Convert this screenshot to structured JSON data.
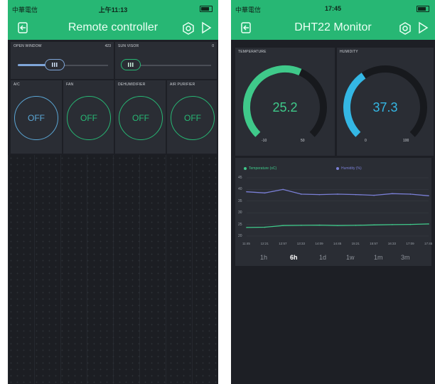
{
  "left": {
    "status": {
      "carrier": "中華電信",
      "time": "上午11:13"
    },
    "title": "Remote controller",
    "sliders": [
      {
        "label": "OPEN WINDOW",
        "value": "423",
        "level": 0.42
      },
      {
        "label": "SUN VISOR",
        "value": "0",
        "level": 0.0
      }
    ],
    "buttons": [
      {
        "label": "A/C",
        "state": "OFF"
      },
      {
        "label": "FAN",
        "state": "OFF"
      },
      {
        "label": "DEHUMIDIFIER",
        "state": "OFF"
      },
      {
        "label": "AIR PURIFIER",
        "state": "OFF"
      }
    ],
    "colors": {
      "accent": "#27b774",
      "slider": "#7fa6d9",
      "button_blue": "#5ba7d6"
    }
  },
  "right": {
    "status": {
      "carrier": "中華電信",
      "time": "17:45"
    },
    "title": "DHT22 Monitor",
    "gauges": [
      {
        "label": "TEMPERATURE",
        "value": "25.2",
        "min": "-10",
        "max": "50",
        "color": "#3fc98a"
      },
      {
        "label": "HUMIDITY",
        "value": "37.3",
        "min": "0",
        "max": "100",
        "color": "#34b7e4"
      }
    ],
    "chart": {
      "legend": [
        "Temperature (oC)",
        "Humidity (%)"
      ],
      "time_ranges": [
        "1h",
        "6h",
        "1d",
        "1w",
        "1m",
        "3m"
      ],
      "active_range": "6h"
    },
    "chart_data": {
      "type": "line",
      "x": [
        "11:45",
        "12:21",
        "12:57",
        "13:33",
        "14:09",
        "14:45",
        "15:21",
        "15:57",
        "16:33",
        "17:09",
        "17:45"
      ],
      "ylim": [
        20,
        45
      ],
      "yticks": [
        "45",
        "40",
        "35",
        "30",
        "25",
        "20"
      ],
      "series": [
        {
          "name": "Temperature (oC)",
          "color": "#3fc98a",
          "values": [
            23.7,
            23.8,
            24.5,
            24.6,
            24.7,
            24.5,
            24.6,
            24.8,
            24.9,
            25.0,
            25.2
          ]
        },
        {
          "name": "Humidity (%)",
          "color": "#7a7fd6",
          "values": [
            39.0,
            38.5,
            40.0,
            38.0,
            37.8,
            38.0,
            37.8,
            37.5,
            38.2,
            38.0,
            37.3
          ]
        }
      ]
    }
  },
  "icons": {
    "exit": "exit-icon",
    "settings": "gear-icon",
    "play": "play-icon",
    "wifi": "wifi-icon"
  }
}
